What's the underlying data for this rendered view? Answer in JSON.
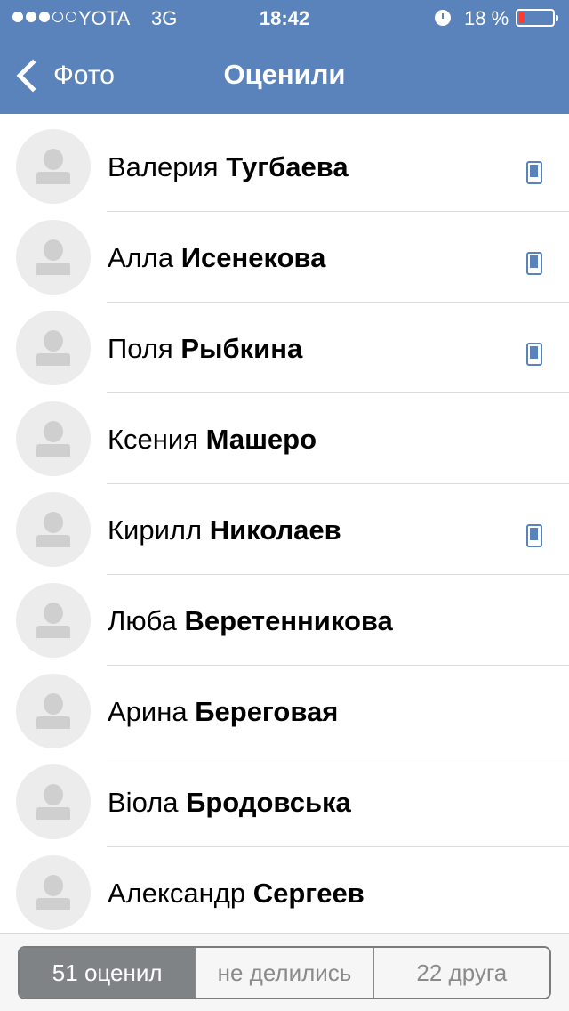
{
  "status_bar": {
    "carrier": "YOTA",
    "network": "3G",
    "time": "18:42",
    "battery_percent": "18 %",
    "battery_level": 0.18
  },
  "nav": {
    "back_label": "Фото",
    "title": "Оценили"
  },
  "users": [
    {
      "first": "Валерия",
      "last": "Тугбаева",
      "mobile": true
    },
    {
      "first": "Алла",
      "last": "Исенекова",
      "mobile": true
    },
    {
      "first": "Поля",
      "last": "Рыбкина",
      "mobile": true
    },
    {
      "first": "Ксения",
      "last": "Машеро",
      "mobile": false
    },
    {
      "first": "Кирилл",
      "last": "Николаев",
      "mobile": true
    },
    {
      "first": "Люба",
      "last": "Веретенникова",
      "mobile": false
    },
    {
      "first": "Арина",
      "last": "Береговая",
      "mobile": false
    },
    {
      "first": "Віола",
      "last": "Бродовська",
      "mobile": false
    },
    {
      "first": "Александр",
      "last": "Сергеев",
      "mobile": false
    }
  ],
  "segments": [
    {
      "label": "51 оценил",
      "active": true
    },
    {
      "label": "не делились",
      "active": false
    },
    {
      "label": "22 друга",
      "active": false
    }
  ],
  "colors": {
    "nav_bar": "#5b83bb",
    "mobile_icon": "#5b83bb",
    "active_segment": "#808386",
    "battery_low": "#ff3b30"
  }
}
